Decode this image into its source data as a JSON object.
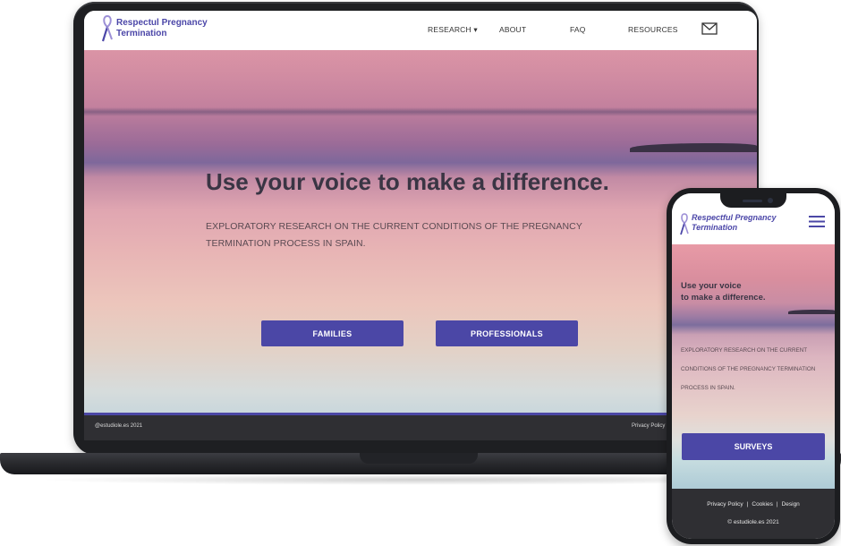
{
  "site": {
    "logo_line1": "Respectul Pregnancy",
    "logo_line2": "Termination",
    "brand_color": "#4b47a6"
  },
  "desktop": {
    "nav": [
      {
        "label": "RESEARCH ▾",
        "icon": "caret-down-icon"
      },
      {
        "label": "ABOUT"
      },
      {
        "label": "FAQ"
      },
      {
        "label": "RESOURCES"
      }
    ],
    "mail_icon": "mail-icon",
    "hero": {
      "title": "Use your voice to make a difference.",
      "subtitle": "EXPLORATORY RESEARCH ON THE CURRENT CONDITIONS OF THE PREGNANCY TERMINATION PROCESS IN SPAIN.",
      "buttons": [
        "FAMILIES",
        "PROFESSIONALS"
      ]
    },
    "footer": {
      "copyright": "@estudiole.es  2021",
      "privacy": "Privacy Policy"
    }
  },
  "mobile": {
    "logo_line1": "Respectful Pregnancy",
    "logo_line2": "Termination",
    "menu_icon": "hamburger-icon",
    "hero": {
      "title_line1": "Use your voice",
      "title_line2": "to make a difference.",
      "subtitle": "EXPLORATORY RESEARCH ON THE CURRENT CONDITIONS OF THE PREGNANCY TERMINATION PROCESS IN SPAIN.",
      "button": "SURVEYS"
    },
    "footer": {
      "links": [
        "Privacy Policy",
        "Cookies",
        "Design"
      ],
      "copyright": "© estudiole.es  2021"
    }
  }
}
